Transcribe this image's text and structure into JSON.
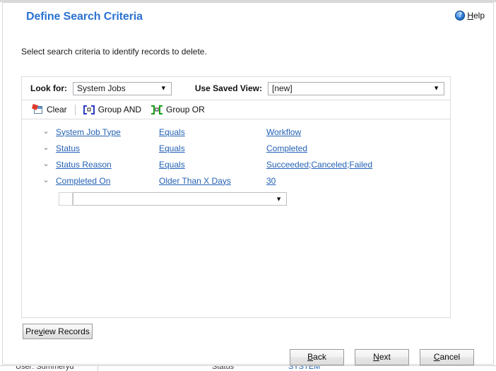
{
  "header": {
    "title": "Define Search Criteria",
    "help_label": "Help",
    "help_accel": "H",
    "help_icon": "question-circle-icon"
  },
  "subtitle": "Select search criteria to identify records to delete.",
  "lookfor": {
    "label": "Look for:",
    "value": "System Jobs",
    "arrow": "▼"
  },
  "saved_view": {
    "label": "Use Saved View:",
    "value": "[new]",
    "arrow": "▼"
  },
  "toolbar": {
    "clear_label": "Clear",
    "clear_icon": "clear-icon",
    "group_and_label": "Group AND",
    "group_and_icon": "group-and-brackets-icon",
    "group_or_label": "Group OR",
    "group_or_icon": "group-or-brackets-icon"
  },
  "criteria": {
    "chevron": "⌄",
    "rows": [
      {
        "field": "System Job Type",
        "operator": "Equals",
        "value": "Workflow"
      },
      {
        "field": "Status",
        "operator": "Equals",
        "value": "Completed"
      },
      {
        "field": "Status Reason",
        "operator": "Equals",
        "value": "Succeeded;Canceled;Failed"
      },
      {
        "field": "Completed On",
        "operator": "Older Than X Days",
        "value": "30"
      }
    ],
    "new_row": {
      "value": "",
      "arrow": "▼"
    }
  },
  "buttons": {
    "preview": {
      "pre": "Pre",
      "accel": "v",
      "post": "iew Records"
    },
    "back": {
      "pre": "",
      "accel": "B",
      "post": "ack"
    },
    "next": {
      "pre": "",
      "accel": "N",
      "post": "ext"
    },
    "cancel": {
      "pre": "",
      "accel": "C",
      "post": "ancel"
    }
  },
  "statusbar": {
    "user_text": "User: Summeryd",
    "mid_text": "Status",
    "right_text": "SYSTEM"
  },
  "colors": {
    "title_blue": "#2b73d2",
    "link_blue": "#2462b5",
    "panel_border": "#dcdcdc",
    "group_and": "#2a3bc4",
    "group_or": "#13a013"
  }
}
